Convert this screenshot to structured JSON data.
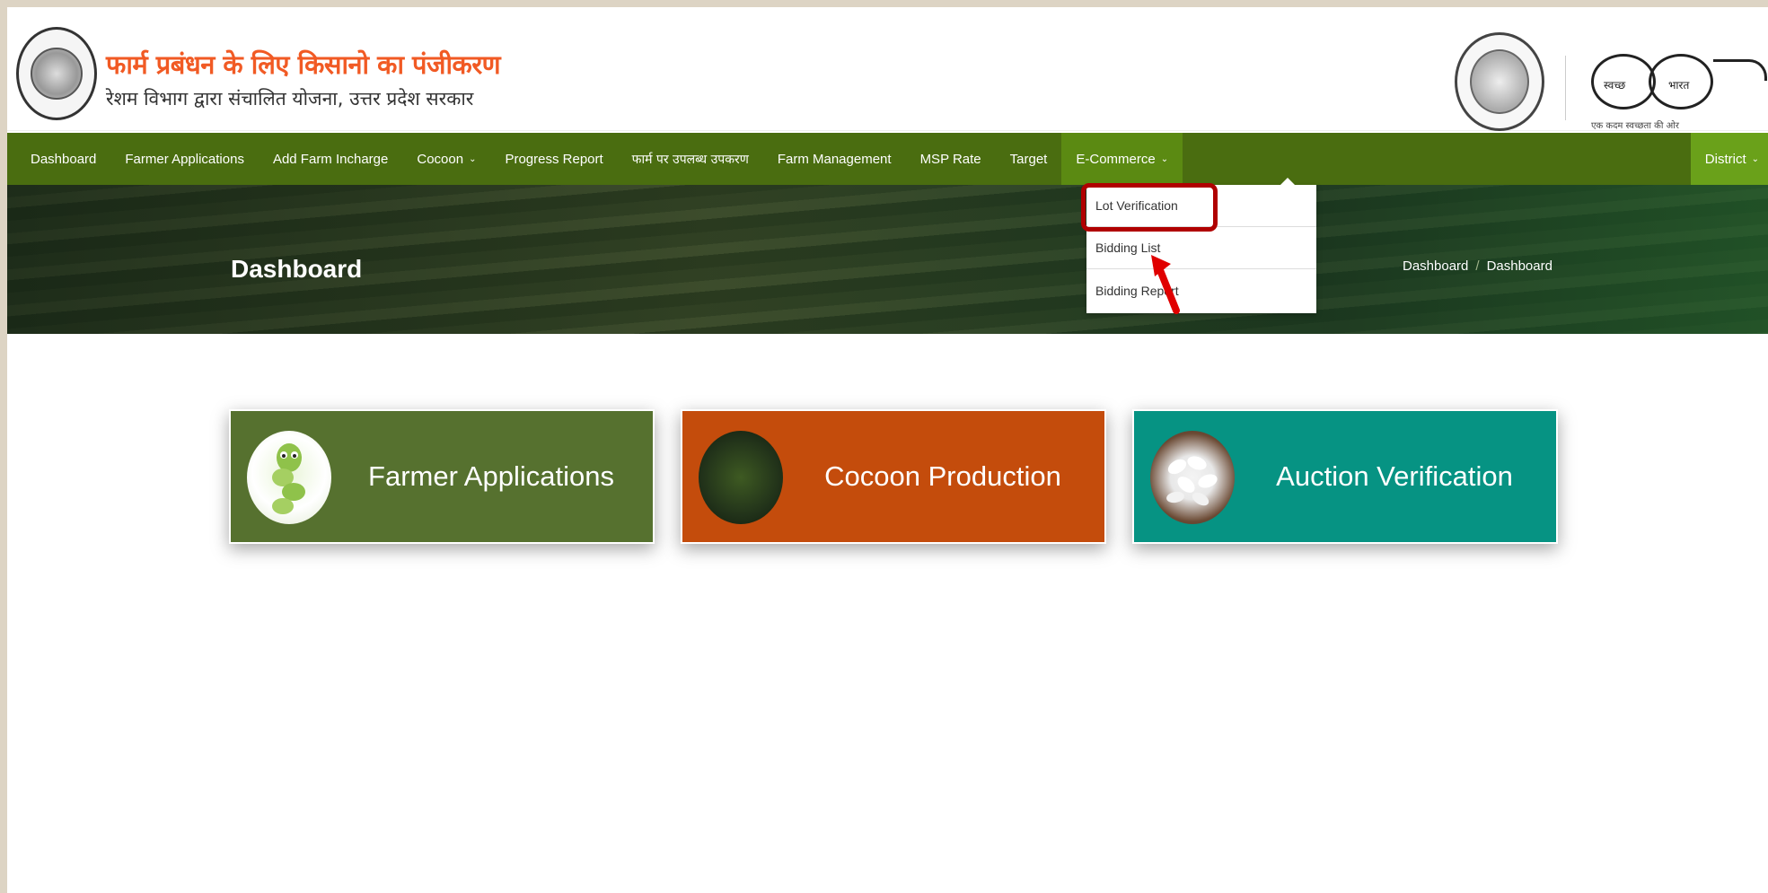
{
  "header": {
    "title": "फार्म प्रबंधन के लिए किसानो का पंजीकरण",
    "subtitle": "रेशम विभाग द्वारा संचालित योजना, उत्तर प्रदेश सरकार",
    "swachh_word1": "स्वच्छ",
    "swachh_word2": "भारत",
    "swachh_tagline": "एक कदम स्वच्छता की ओर"
  },
  "nav": {
    "items": [
      {
        "label": "Dashboard"
      },
      {
        "label": "Farmer Applications"
      },
      {
        "label": "Add Farm Incharge"
      },
      {
        "label": "Cocoon"
      },
      {
        "label": "Progress Report"
      },
      {
        "label": "फार्म पर उपलब्ध उपकरण"
      },
      {
        "label": "Farm Management"
      },
      {
        "label": "MSP Rate"
      },
      {
        "label": "Target"
      },
      {
        "label": "E-Commerce"
      }
    ],
    "right": "District"
  },
  "dropdown": {
    "items": [
      {
        "label": "Lot Verification"
      },
      {
        "label": "Bidding List"
      },
      {
        "label": "Bidding Report"
      }
    ]
  },
  "banner": {
    "title": "Dashboard",
    "breadcrumb": [
      "Dashboard",
      "Dashboard"
    ],
    "separator": "/"
  },
  "cards": [
    {
      "label": "Farmer Applications",
      "color": "#56712f"
    },
    {
      "label": "Cocoon Production",
      "color": "#c44c0c"
    },
    {
      "label": "Auction Verification",
      "color": "#069383"
    }
  ],
  "colors": {
    "nav_bg": "#4a6d10",
    "nav_active": "#5b8a12",
    "title_orange": "#f15a24",
    "highlight_red": "#b00000"
  },
  "icons": {
    "caret": "chevron-down-icon"
  }
}
